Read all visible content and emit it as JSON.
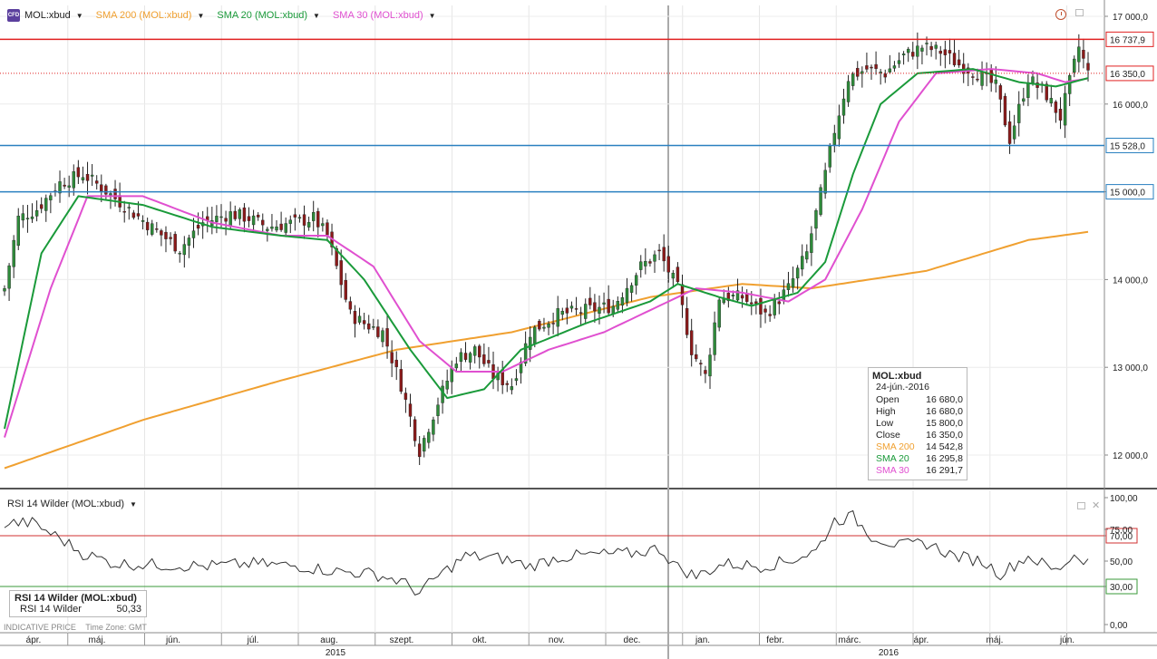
{
  "legend": {
    "icon_text": "CFD",
    "symbol": "MOL:xbud",
    "sma200": "SMA 200 (MOL:xbud)",
    "sma20": "SMA 20 (MOL:xbud)",
    "sma30": "SMA 30 (MOL:xbud)"
  },
  "rsi_legend": {
    "label": "RSI 14 Wilder (MOL:xbud)"
  },
  "infobox": {
    "title": "MOL:xbud",
    "date": "24-jún.-2016",
    "rows": [
      {
        "label": "Open",
        "value": "16 680,0"
      },
      {
        "label": "High",
        "value": "16 680,0"
      },
      {
        "label": "Low",
        "value": "15 800,0"
      },
      {
        "label": "Close",
        "value": "16 350,0"
      },
      {
        "label": "SMA 200",
        "value": "14 542,8"
      },
      {
        "label": "SMA 20",
        "value": "16 295,8"
      },
      {
        "label": "SMA 30",
        "value": "16 291,7"
      }
    ]
  },
  "rsibox": {
    "title": "RSI 14 Wilder (MOL:xbud)",
    "label": "RSI 14 Wilder",
    "value": "50,33"
  },
  "footer": {
    "price_note": "INDICATIVE PRICE",
    "timezone": "Time Zone: GMT"
  },
  "colors": {
    "up": "#2e8b3a",
    "down": "#8b1a1a",
    "sma200": "#f0a030",
    "sma20": "#1a9a3a",
    "sma30": "#e050d0",
    "resistance": "#e02020",
    "support": "#2a80c0",
    "rsi": "#333333",
    "rsi_upper": "#d03030",
    "rsi_lower": "#3a9a3a"
  },
  "icons": {
    "clock": "clock-icon",
    "window": "window-icon",
    "close": "close-icon"
  },
  "chart_data": [
    {
      "type": "candlestick",
      "symbol": "MOL:xbud",
      "y_ticks": [
        "12 000,0",
        "13 000,0",
        "14 000,0",
        "15 000,0",
        "16 000,0",
        "17 000,0"
      ],
      "ylim": [
        11700,
        17150
      ],
      "x_labels": [
        "ápr.",
        "máj.",
        "jún.",
        "júl.",
        "aug.",
        "szept.",
        "okt.",
        "nov.",
        "dec.",
        "jan.",
        "febr.",
        "márc.",
        "ápr.",
        "máj.",
        "jún."
      ],
      "year_labels": [
        "2015",
        "2016"
      ],
      "levels": [
        {
          "name": "resistance",
          "value": 16737.9,
          "label": "16 737,9",
          "style": "solid"
        },
        {
          "name": "last",
          "value": 16350,
          "label": "16 350,0",
          "style": "dotted"
        },
        {
          "name": "support-high",
          "value": 15528,
          "label": "15 528,0",
          "style": "solid"
        },
        {
          "name": "support-low",
          "value": 15000,
          "label": "15 000,0",
          "style": "solid"
        }
      ],
      "close_waypoints": [
        [
          0,
          13900
        ],
        [
          3,
          14700
        ],
        [
          7,
          14800
        ],
        [
          12,
          15100
        ],
        [
          17,
          15200
        ],
        [
          21,
          15050
        ],
        [
          27,
          14800
        ],
        [
          33,
          14550
        ],
        [
          38,
          14350
        ],
        [
          43,
          14650
        ],
        [
          49,
          14750
        ],
        [
          53,
          14700
        ],
        [
          57,
          14600
        ],
        [
          63,
          14650
        ],
        [
          67,
          14700
        ],
        [
          70,
          14500
        ],
        [
          75,
          13600
        ],
        [
          78,
          13500
        ],
        [
          82,
          13400
        ],
        [
          86,
          12800
        ],
        [
          90,
          12050
        ],
        [
          94,
          12600
        ],
        [
          98,
          13100
        ],
        [
          102,
          13200
        ],
        [
          106,
          12900
        ],
        [
          110,
          12800
        ],
        [
          114,
          13400
        ],
        [
          120,
          13600
        ],
        [
          126,
          13650
        ],
        [
          132,
          13700
        ],
        [
          138,
          14150
        ],
        [
          142,
          14300
        ],
        [
          146,
          13900
        ],
        [
          149,
          13200
        ],
        [
          152,
          12900
        ],
        [
          155,
          13800
        ],
        [
          160,
          13800
        ],
        [
          165,
          13600
        ],
        [
          170,
          13900
        ],
        [
          174,
          14300
        ],
        [
          178,
          15200
        ],
        [
          180,
          15700
        ],
        [
          183,
          16300
        ],
        [
          187,
          16400
        ],
        [
          191,
          16350
        ],
        [
          195,
          16550
        ],
        [
          199,
          16650
        ],
        [
          203,
          16600
        ],
        [
          207,
          16450
        ],
        [
          211,
          16350
        ],
        [
          215,
          16200
        ],
        [
          218,
          15600
        ],
        [
          222,
          16300
        ],
        [
          226,
          16100
        ],
        [
          229,
          15850
        ],
        [
          233,
          16650
        ],
        [
          235,
          16350
        ]
      ],
      "sma200_waypoints": [
        [
          0,
          11850
        ],
        [
          30,
          12400
        ],
        [
          60,
          12850
        ],
        [
          85,
          13200
        ],
        [
          110,
          13400
        ],
        [
          140,
          13800
        ],
        [
          160,
          13950
        ],
        [
          175,
          13900
        ],
        [
          200,
          14100
        ],
        [
          222,
          14450
        ],
        [
          235,
          14543
        ]
      ],
      "sma20_waypoints": [
        [
          0,
          12300
        ],
        [
          8,
          14300
        ],
        [
          16,
          14950
        ],
        [
          30,
          14850
        ],
        [
          45,
          14600
        ],
        [
          60,
          14500
        ],
        [
          70,
          14450
        ],
        [
          78,
          14000
        ],
        [
          88,
          13200
        ],
        [
          96,
          12650
        ],
        [
          104,
          12750
        ],
        [
          112,
          13200
        ],
        [
          126,
          13500
        ],
        [
          140,
          13750
        ],
        [
          146,
          13950
        ],
        [
          155,
          13800
        ],
        [
          162,
          13700
        ],
        [
          172,
          13850
        ],
        [
          178,
          14200
        ],
        [
          184,
          15200
        ],
        [
          190,
          16000
        ],
        [
          198,
          16350
        ],
        [
          210,
          16400
        ],
        [
          220,
          16250
        ],
        [
          228,
          16200
        ],
        [
          235,
          16296
        ]
      ],
      "sma30_waypoints": [
        [
          0,
          12200
        ],
        [
          10,
          13900
        ],
        [
          18,
          14950
        ],
        [
          30,
          14950
        ],
        [
          45,
          14650
        ],
        [
          60,
          14500
        ],
        [
          70,
          14500
        ],
        [
          80,
          14150
        ],
        [
          90,
          13300
        ],
        [
          98,
          12950
        ],
        [
          108,
          12950
        ],
        [
          118,
          13200
        ],
        [
          130,
          13400
        ],
        [
          142,
          13700
        ],
        [
          150,
          13900
        ],
        [
          160,
          13850
        ],
        [
          170,
          13750
        ],
        [
          178,
          14000
        ],
        [
          186,
          14800
        ],
        [
          194,
          15800
        ],
        [
          202,
          16350
        ],
        [
          214,
          16400
        ],
        [
          224,
          16350
        ],
        [
          230,
          16250
        ],
        [
          235,
          16292
        ]
      ]
    },
    {
      "type": "line",
      "name": "RSI 14 Wilder",
      "y_ticks": [
        "0,00",
        "30,00",
        "50,00",
        "70,00",
        "75,00",
        "100,00"
      ],
      "ylim": [
        0,
        100
      ],
      "levels": [
        {
          "value": 70,
          "label": "70,00"
        },
        {
          "value": 30,
          "label": "30,00"
        }
      ],
      "last": 50.33,
      "waypoints": [
        [
          0,
          80
        ],
        [
          6,
          80
        ],
        [
          12,
          68
        ],
        [
          17,
          56
        ],
        [
          24,
          48
        ],
        [
          34,
          47
        ],
        [
          44,
          46
        ],
        [
          54,
          48
        ],
        [
          64,
          46
        ],
        [
          72,
          42
        ],
        [
          80,
          40
        ],
        [
          86,
          34
        ],
        [
          90,
          25
        ],
        [
          94,
          38
        ],
        [
          100,
          54
        ],
        [
          108,
          52
        ],
        [
          114,
          46
        ],
        [
          120,
          53
        ],
        [
          128,
          55
        ],
        [
          136,
          56
        ],
        [
          142,
          60
        ],
        [
          146,
          45
        ],
        [
          150,
          38
        ],
        [
          156,
          48
        ],
        [
          164,
          46
        ],
        [
          170,
          50
        ],
        [
          176,
          58
        ],
        [
          180,
          82
        ],
        [
          184,
          85
        ],
        [
          188,
          70
        ],
        [
          194,
          62
        ],
        [
          200,
          64
        ],
        [
          206,
          54
        ],
        [
          212,
          50
        ],
        [
          216,
          40
        ],
        [
          222,
          54
        ],
        [
          228,
          42
        ],
        [
          232,
          55
        ],
        [
          235,
          50
        ]
      ]
    }
  ]
}
